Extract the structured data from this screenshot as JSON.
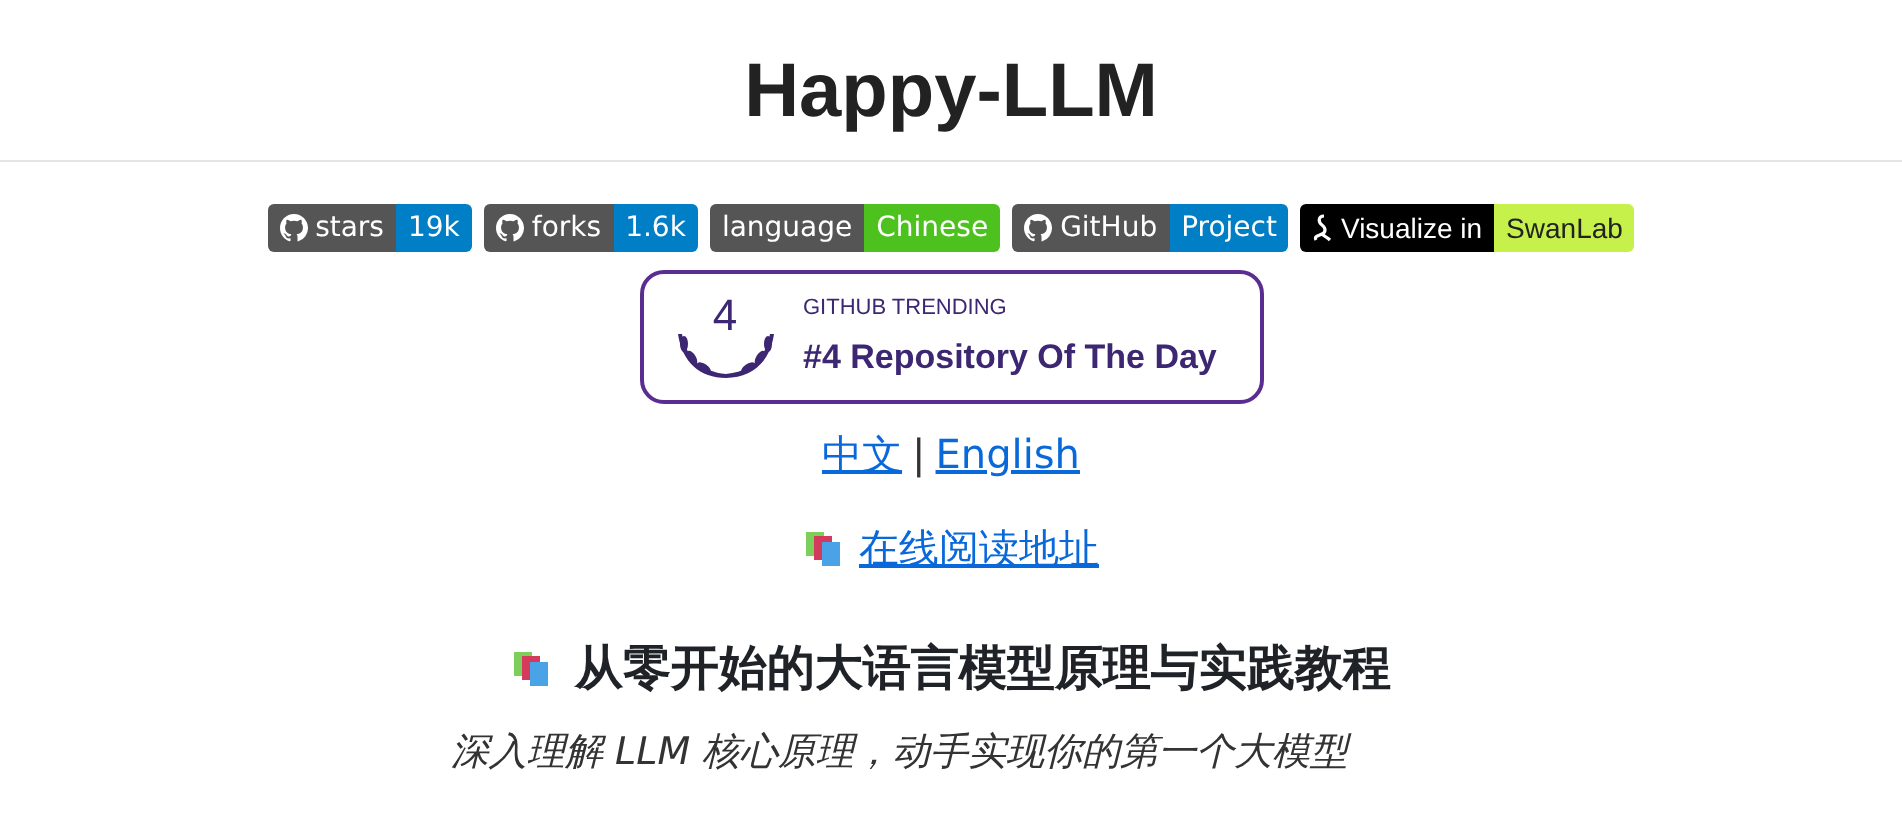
{
  "title": "Happy-LLM",
  "badges": [
    {
      "kind": "github",
      "label": "stars",
      "value": "19k",
      "color": "#007ec6"
    },
    {
      "kind": "github",
      "label": "forks",
      "value": "1.6k",
      "color": "#007ec6"
    },
    {
      "kind": "plain",
      "label": "language",
      "value": "Chinese",
      "color": "#4dc21f"
    },
    {
      "kind": "github",
      "label": "GitHub",
      "value": "Project",
      "color": "#007ec6"
    },
    {
      "kind": "swanlab",
      "label": "Visualize in",
      "value": "SwanLab",
      "color": "#c6f14a"
    }
  ],
  "trending": {
    "rank": "4",
    "caption": "GITHUB TRENDING",
    "headline": "#4 Repository Of The Day"
  },
  "language_links": [
    {
      "label": "中文"
    },
    {
      "label": "English"
    }
  ],
  "separator": "|",
  "read_online": "在线阅读地址",
  "heading": "从零开始的大语言模型原理与实践教程",
  "subtitle": "深入理解 LLM 核心原理，动手实现你的第一个大模型"
}
